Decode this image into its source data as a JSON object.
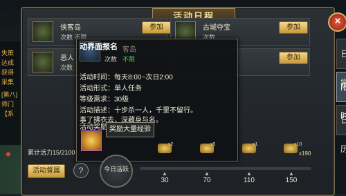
{
  "panel": {
    "title": "活动日程",
    "close_label": "×",
    "tabs": [
      {
        "label": "日常",
        "active": false
      },
      {
        "label": "限时",
        "active": true
      },
      {
        "label": "日历",
        "active": false
      }
    ]
  },
  "events": [
    {
      "name": "侠客岛",
      "sub": "次数  不限",
      "button": "参加"
    },
    {
      "name": "古城夺宝",
      "sub": "次数",
      "button": "参加"
    },
    {
      "name": "恶人",
      "sub": "次数",
      "button": ""
    },
    {
      "name": "",
      "sub": "",
      "button": "参加"
    }
  ],
  "popup": {
    "title": "动界面报名",
    "ghost_text": "客岛",
    "count_label": "次数",
    "count_value": "不限",
    "time": "活动时间：每天8:00~次日2:00",
    "form": "活动形式：单人任务",
    "level": "等级需求：30级",
    "desc1": "活动描述：十步杀一人，千里不留行。",
    "desc2": "事了拂衣去，深藏身与名。",
    "reward_label": "活动奖励",
    "reward_tip": "奖励大量经验"
  },
  "bottom": {
    "vitality": "累计活力15/2100",
    "vitality_button": "活动督属",
    "help": "?",
    "today_label": "今日活跃",
    "progress": 0.0,
    "milestones": [
      {
        "value": "30",
        "icon_text": "x2"
      },
      {
        "value": "70",
        "icon_text": "x5"
      },
      {
        "value": "110",
        "icon_text": "x1"
      },
      {
        "value": "150",
        "icon_text": "x10"
      }
    ],
    "right_reward": "x190"
  },
  "left_hud": {
    "lines": [
      "失策",
      "达成",
      "获得",
      "采集",
      "[第八]",
      "师门",
      "【系"
    ]
  },
  "colors": {
    "accent": "#d7b35a",
    "panel_border": "#6b6048",
    "count_green": "#46d746",
    "close_red": "#c8381f"
  }
}
